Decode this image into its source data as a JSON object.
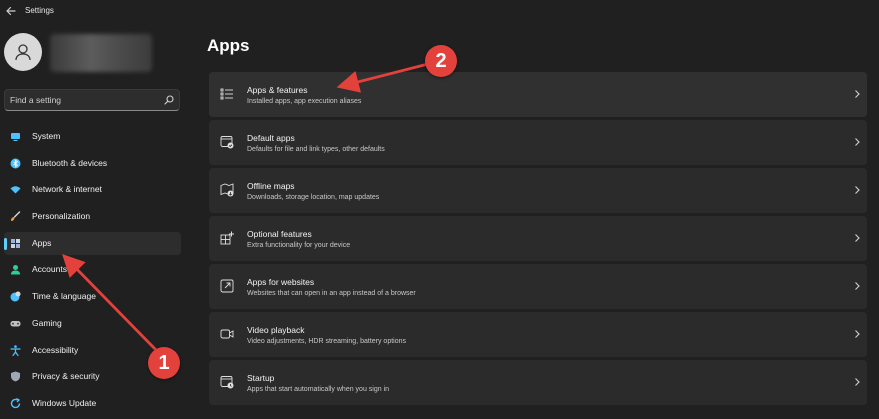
{
  "window": {
    "title": "Settings"
  },
  "search": {
    "placeholder": "Find a setting"
  },
  "sidebar": {
    "items": [
      {
        "label": "System",
        "icon": "monitor-icon",
        "color": "#4cc2ff"
      },
      {
        "label": "Bluetooth & devices",
        "icon": "bluetooth-icon",
        "color": "#4cc2ff"
      },
      {
        "label": "Network & internet",
        "icon": "wifi-icon",
        "color": "#4cc2ff"
      },
      {
        "label": "Personalization",
        "icon": "brush-icon",
        "color": "#f0a050"
      },
      {
        "label": "Apps",
        "icon": "apps-icon",
        "color": "#9cb3d6",
        "selected": true
      },
      {
        "label": "Accounts",
        "icon": "person-icon",
        "color": "#2fcf8f"
      },
      {
        "label": "Time & language",
        "icon": "globe-clock-icon",
        "color": "#4cc2ff"
      },
      {
        "label": "Gaming",
        "icon": "gamepad-icon",
        "color": "#c0c0c0"
      },
      {
        "label": "Accessibility",
        "icon": "accessibility-icon",
        "color": "#4cc2ff"
      },
      {
        "label": "Privacy & security",
        "icon": "shield-icon",
        "color": "#a0a8b8"
      },
      {
        "label": "Windows Update",
        "icon": "update-icon",
        "color": "#4cc2ff"
      }
    ]
  },
  "main": {
    "title": "Apps",
    "cards": [
      {
        "title": "Apps & features",
        "description": "Installed apps, app execution aliases",
        "icon": "list-icon"
      },
      {
        "title": "Default apps",
        "description": "Defaults for file and link types, other defaults",
        "icon": "default-apps-icon"
      },
      {
        "title": "Offline maps",
        "description": "Downloads, storage location, map updates",
        "icon": "map-icon"
      },
      {
        "title": "Optional features",
        "description": "Extra functionality for your device",
        "icon": "grid-plus-icon"
      },
      {
        "title": "Apps for websites",
        "description": "Websites that can open in an app instead of a browser",
        "icon": "open-link-icon"
      },
      {
        "title": "Video playback",
        "description": "Video adjustments, HDR streaming, battery options",
        "icon": "video-icon"
      },
      {
        "title": "Startup",
        "description": "Apps that start automatically when you sign in",
        "icon": "startup-icon"
      }
    ]
  },
  "annotations": {
    "badge1": "1",
    "badge2": "2",
    "color": "#e2413c"
  },
  "accent_color": "#60cdff"
}
